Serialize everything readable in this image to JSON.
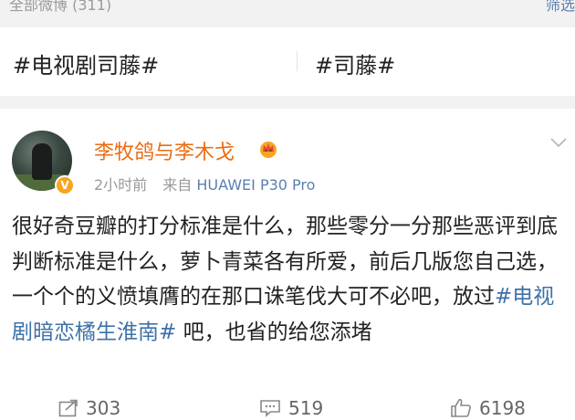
{
  "top_strip": {
    "count_label": "全部微博 (311)",
    "filter_label": "筛选"
  },
  "topics": [
    "#电视剧司藤#",
    "#司藤#"
  ],
  "post": {
    "username": "李牧鸽与李木戈",
    "verified_badge": "V",
    "time": "2小时前",
    "source_prefix": "来自",
    "device": "HUAWEI P30 Pro",
    "text_before": "很好奇豆瓣的打分标准是什么，那些零分一分那些恶评到底判断标准是什么，萝卜青菜各有所爱，前后几版您自己选，一个个的义愤填膺的在那口诛笔伐大可不必吧，放过",
    "hashtag": "#电视剧暗恋橘生淮南#",
    "text_after": " 吧，也省的给您添堵",
    "actions": {
      "repost_count": "303",
      "comment_count": "519",
      "like_count": "6198"
    }
  },
  "colors": {
    "username": "#eb6d12",
    "link": "#3f71a8",
    "meta": "#999999",
    "background": "#f2f2f2"
  },
  "icons": [
    "crown-icon",
    "chevron-down-icon",
    "repost-icon",
    "comment-icon",
    "like-icon"
  ]
}
